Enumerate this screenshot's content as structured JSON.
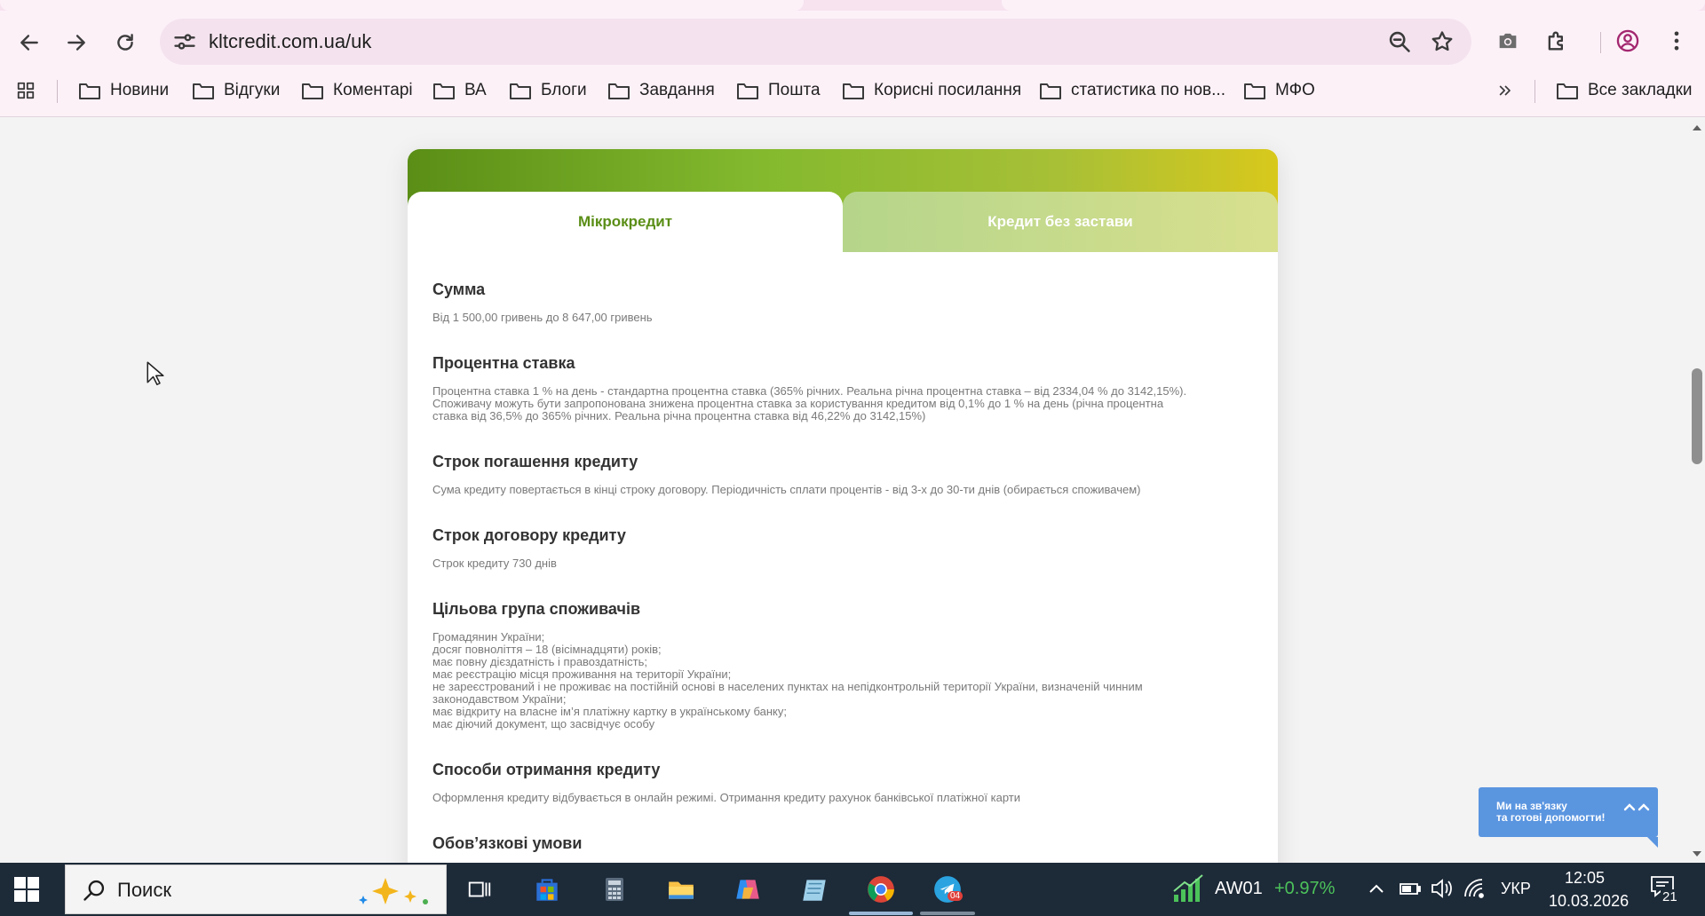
{
  "browser": {
    "url": "kltcredit.com.ua/uk",
    "bookmarks": [
      "Новини",
      "Відгуки",
      "Коментарі",
      "ВА",
      "Блоги",
      "Завдання",
      "Пошта",
      "Корисні посилання",
      "статистика по нов...",
      "МФО"
    ],
    "all_bookmarks": "Все закладки"
  },
  "card": {
    "tabs": [
      {
        "label": "Мікрокредит",
        "active": true
      },
      {
        "label": "Кредит без застави",
        "active": false
      }
    ],
    "sections": [
      {
        "title": "Сумма",
        "lines": [
          "Від 1 500,00 гривень до 8 647,00 гривень"
        ]
      },
      {
        "title": "Процентна ставка",
        "lines": [
          "Процентна ставка 1 % на день - стандартна процентна ставка (365% річних. Реальна річна процентна ставка – від 2334,04 % до 3142,15%).",
          "Споживачу можуть бути запропонована знижена процентна ставка за користування кредитом від 0,1% до 1 % на день (річна процентна",
          "ставка від 36,5% до 365% річних. Реальна річна процентна ставка від 46,22% до 3142,15%)"
        ]
      },
      {
        "title": "Строк погашення кредиту",
        "lines": [
          "Сума кредиту повертається в кінці строку договору. Періодичність сплати процентів - від 3-х до 30-ти днів (обирається споживачем)"
        ]
      },
      {
        "title": "Строк договору кредиту",
        "lines": [
          "Строк кредиту 730 днів"
        ]
      },
      {
        "title": "Цільова група споживачів",
        "lines": [
          "Громадянин України;",
          "досяг повноліття – 18 (вісімнадцяти) років;",
          "має повну дієздатність і правоздатність;",
          "має реєстрацію місця проживання на території України;",
          "не зареєстрований і не проживає на постійній основі в населених пунктах на непідконтрольній території України, визначеній чинним",
          "законодавством України;",
          "має відкриту на власне ім’я платіжну картку в українському банку;",
          "має діючий документ, що засвідчує особу"
        ]
      },
      {
        "title": "Способи отримання кредиту",
        "lines": [
          "Оформлення кредиту відбувається в онлайн режимі. Отримання кредиту рахунок банківської платіжної карти"
        ]
      },
      {
        "title": "Обов’язкові умови",
        "lines": []
      }
    ]
  },
  "chat_widget": {
    "line1": "Ми на зв'язку",
    "line2": "та готові допомогти!"
  },
  "taskbar": {
    "search_placeholder": "Поиск",
    "ticker_name": "AW01",
    "ticker_change": "+0.97%",
    "language": "УКР",
    "time": "12:05",
    "date": "10.03.2026",
    "notifications": "21",
    "telegram_badge": "04"
  },
  "colors": {
    "brand_green": "#5a8e16",
    "brand_yellow": "#d8c81c",
    "chat_blue": "#5a95e0",
    "taskbar": "#1d2a38"
  }
}
